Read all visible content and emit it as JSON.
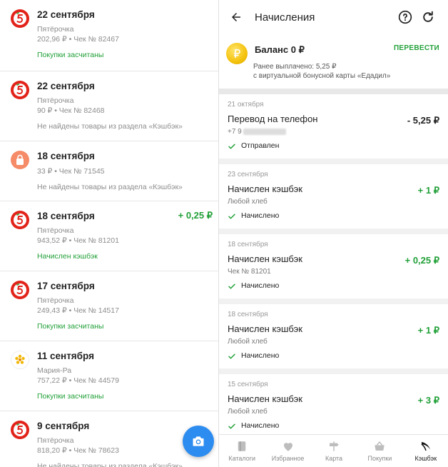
{
  "left": {
    "receipts": [
      {
        "date": "22 сентября",
        "store": "Пятёрочка",
        "info": "202,96 ₽ • Чек № 82467",
        "status": "Покупки засчитаны",
        "status_type": "green",
        "amount": "",
        "icon": "pyaterochka-logo"
      },
      {
        "date": "22 сентября",
        "store": "Пятёрочка",
        "info": "90 ₽ • Чек № 82468",
        "status": "Не найдены товары из раздела «Кэшбэк»",
        "status_type": "grey",
        "amount": "",
        "icon": "pyaterochka-logo"
      },
      {
        "date": "18 сентября",
        "store": "",
        "info": "33 ₽ • Чек № 71545",
        "status": "Не найдены товары из раздела «Кэшбэк»",
        "status_type": "grey",
        "amount": "",
        "icon": "shopping-bag-icon"
      },
      {
        "date": "18 сентября",
        "store": "Пятёрочка",
        "info": "943,52 ₽ • Чек № 81201",
        "status": "Начислен кэшбэк",
        "status_type": "green",
        "amount": "+ 0,25 ₽",
        "icon": "pyaterochka-logo"
      },
      {
        "date": "17 сентября",
        "store": "Пятёрочка",
        "info": "249,43 ₽ • Чек № 14517",
        "status": "Покупки засчитаны",
        "status_type": "green",
        "amount": "",
        "icon": "pyaterochka-logo"
      },
      {
        "date": "11 сентября",
        "store": "Мария-Ра",
        "info": "757,22 ₽ • Чек № 44579",
        "status": "Покупки засчитаны",
        "status_type": "green",
        "amount": "",
        "icon": "maria-ra-logo"
      },
      {
        "date": "9 сентября",
        "store": "Пятёрочка",
        "info": "818,20 ₽ • Чек № 78623",
        "status": "Не найдены товары из раздела «Кэшбэк»",
        "status_type": "grey",
        "amount": "",
        "icon": "pyaterochka-logo"
      }
    ]
  },
  "right": {
    "header": {
      "title": "Начисления"
    },
    "balance": {
      "title": "Баланс 0 ₽",
      "transfer": "ПЕРЕВЕСТИ",
      "note_line1": "Ранее выплачено: 5,25 ₽",
      "note_line2": "с виртуальной бонусной карты «Едадил»"
    },
    "operations": [
      {
        "date": "21 октября",
        "title": "Перевод на телефон",
        "sub": "+7 9",
        "status": "Отправлен",
        "amount": "- 5,25 ₽",
        "sign": "neg",
        "masked": true
      },
      {
        "date": "23 сентября",
        "title": "Начислен кэшбэк",
        "sub": "Любой хлеб",
        "status": "Начислено",
        "amount": "+ 1 ₽",
        "sign": "pos",
        "masked": false
      },
      {
        "date": "18 сентября",
        "title": "Начислен кэшбэк",
        "sub": "Чек № 81201",
        "status": "Начислено",
        "amount": "+ 0,25 ₽",
        "sign": "pos",
        "masked": false
      },
      {
        "date": "18 сентября",
        "title": "Начислен кэшбэк",
        "sub": "Любой хлеб",
        "status": "Начислено",
        "amount": "+ 1 ₽",
        "sign": "pos",
        "masked": false
      },
      {
        "date": "15 сентября",
        "title": "Начислен кэшбэк",
        "sub": "Любой хлеб",
        "status": "Начислено",
        "amount": "+ 3 ₽",
        "sign": "pos",
        "masked": false
      }
    ],
    "nav": [
      {
        "label": "Каталоги",
        "icon": "catalog-icon",
        "active": false
      },
      {
        "label": "Избранное",
        "icon": "heart-icon",
        "active": false
      },
      {
        "label": "Карта",
        "icon": "signpost-icon",
        "active": false
      },
      {
        "label": "Покупки",
        "icon": "basket-icon",
        "active": false
      },
      {
        "label": "Кэшбэк",
        "icon": "cashback-icon",
        "active": true
      }
    ]
  },
  "colors": {
    "green": "#21a038",
    "red": "#e2231a",
    "fab_blue": "#2d8cf0"
  }
}
